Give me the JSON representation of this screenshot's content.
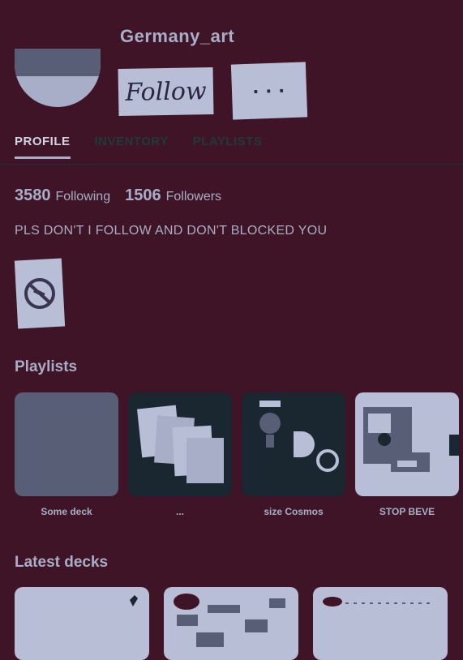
{
  "profile": {
    "username": "Germany_art",
    "follow_label": "Follow",
    "more_label": "· · ·",
    "colors": {
      "background": "#3f1426",
      "text": "#a8aec7",
      "card_dark": "#1a2630"
    }
  },
  "tabs": [
    {
      "label": "PROFILE",
      "active": true
    },
    {
      "label": "INVENTORY",
      "active": false
    },
    {
      "label": "PLAYLISTS",
      "active": false
    }
  ],
  "stats": {
    "following_count": "3580",
    "following_label": "Following",
    "followers_count": "1506",
    "followers_label": "Followers"
  },
  "bio": "PLS DON'T I FOLLOW AND DON'T BLOCKED YOU",
  "badge_icon": "no-symbol-icon",
  "playlists": {
    "title": "Playlists",
    "items": [
      {
        "caption": "Some deck"
      },
      {
        "caption": "..."
      },
      {
        "caption": "size Cosmos"
      },
      {
        "caption": "STOP BEVE"
      }
    ]
  },
  "latest_decks": {
    "title": "Latest decks"
  }
}
